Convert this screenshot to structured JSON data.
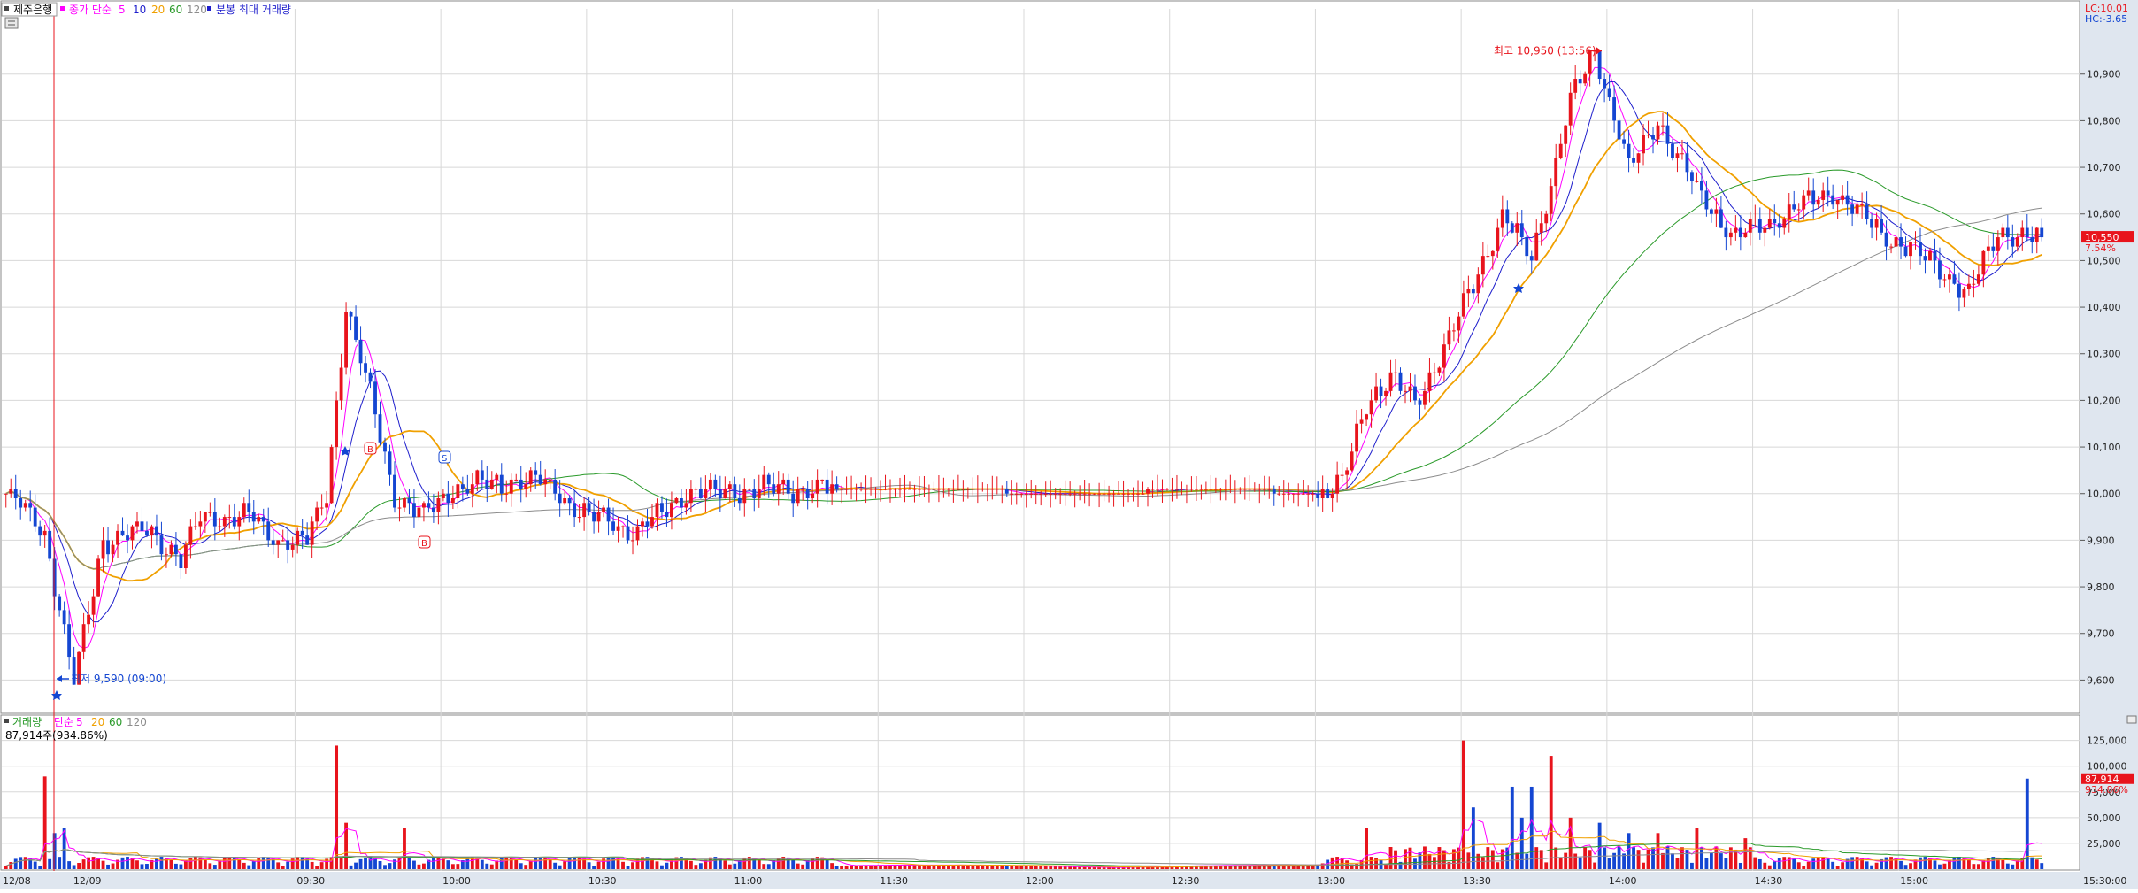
{
  "colors": {
    "up": "#e8141c",
    "down": "#1446d2",
    "ma5": "#ff00ff",
    "ma10": "#1e1ecc",
    "ma20": "#f0a000",
    "ma60": "#2a9a2a",
    "ma120": "#8c8c8c",
    "grid": "#d8d8d8",
    "axis_bg": "#dfe6ef",
    "high_marker": "#e8141c",
    "low_marker": "#1446d2"
  },
  "price_panel": {
    "stock_name": "제주은행",
    "ma_label": "종가 단순",
    "periods": [
      "5",
      "10",
      "20",
      "60",
      "120"
    ],
    "extra_label": "분봉 최대 거래량",
    "lc": "LC:10.01",
    "hc": "HC:-3.65",
    "current_price": "10,550",
    "current_change": "7.54%",
    "high_annotation": "최고 10,950 (13:56)",
    "low_annotation": "최저 9,590 (09:00)",
    "signal_b": "B",
    "signal_s": "S"
  },
  "volume_panel": {
    "title": "거래량",
    "ma_label": "단순",
    "periods": [
      "5",
      "20",
      "60",
      "120"
    ],
    "current_text": "87,914주(934.86%)",
    "current_volume": "87,914",
    "current_ratio": "934.86%"
  },
  "chart_data": [
    {
      "type": "candlestick",
      "title": "제주은행",
      "price_axis_ticks": [
        "9,600",
        "9,700",
        "9,800",
        "9,900",
        "10,000",
        "10,100",
        "10,200",
        "10,300",
        "10,400",
        "10,500",
        "10,600",
        "10,700",
        "10,800",
        "10,900"
      ],
      "price_axis_values": [
        9600,
        9700,
        9800,
        9900,
        10000,
        10100,
        10200,
        10300,
        10400,
        10500,
        10600,
        10700,
        10800,
        10900
      ],
      "time_axis_labels": [
        "12/08",
        "12/09",
        "09:30",
        "10:00",
        "10:30",
        "11:00",
        "11:30",
        "12:00",
        "12:30",
        "13:00",
        "13:30",
        "14:00",
        "14:30",
        "15:00",
        "15:30:00"
      ],
      "ylim": [
        9540,
        11040
      ],
      "high": {
        "value": 10950,
        "time": "13:56"
      },
      "low": {
        "value": 9590,
        "time": "09:00"
      },
      "last": 10550,
      "change_pct": 7.54,
      "price_path": [
        [
          0,
          10000
        ],
        [
          8,
          9920
        ],
        [
          14,
          9590
        ],
        [
          20,
          9900
        ],
        [
          30,
          9920
        ],
        [
          36,
          9860
        ],
        [
          40,
          9950
        ],
        [
          50,
          9950
        ],
        [
          56,
          9900
        ],
        [
          62,
          9900
        ],
        [
          66,
          10000
        ],
        [
          70,
          10400
        ],
        [
          74,
          10250
        ],
        [
          80,
          10000
        ],
        [
          86,
          9950
        ],
        [
          92,
          10010
        ],
        [
          100,
          10020
        ],
        [
          110,
          10030
        ],
        [
          120,
          9950
        ],
        [
          130,
          9920
        ],
        [
          140,
          10000
        ],
        [
          160,
          10010
        ],
        [
          190,
          10010
        ],
        [
          220,
          10000
        ],
        [
          250,
          10010
        ],
        [
          270,
          10000
        ],
        [
          275,
          10020
        ],
        [
          280,
          10200
        ],
        [
          285,
          10250
        ],
        [
          290,
          10190
        ],
        [
          300,
          10400
        ],
        [
          308,
          10600
        ],
        [
          314,
          10500
        ],
        [
          322,
          10840
        ],
        [
          327,
          10950
        ],
        [
          334,
          10700
        ],
        [
          340,
          10800
        ],
        [
          348,
          10650
        ],
        [
          356,
          10550
        ],
        [
          366,
          10600
        ],
        [
          376,
          10650
        ],
        [
          386,
          10560
        ],
        [
          396,
          10500
        ],
        [
          404,
          10430
        ],
        [
          410,
          10560
        ],
        [
          416,
          10550
        ]
      ],
      "moving_averages": [
        "5",
        "10",
        "20",
        "60",
        "120"
      ]
    },
    {
      "type": "bar",
      "title": "거래량",
      "volume_axis_ticks": [
        "25,000",
        "50,000",
        "75,000",
        "100,000",
        "125,000"
      ],
      "volume_axis_values": [
        25000,
        50000,
        75000,
        100000,
        125000
      ],
      "ylim": [
        0,
        135000
      ],
      "last_volume": 87914,
      "spikes": [
        [
          8,
          90000
        ],
        [
          10,
          35000
        ],
        [
          12,
          40000
        ],
        [
          68,
          120000
        ],
        [
          70,
          45000
        ],
        [
          82,
          40000
        ],
        [
          280,
          40000
        ],
        [
          300,
          125000
        ],
        [
          302,
          60000
        ],
        [
          310,
          80000
        ],
        [
          312,
          50000
        ],
        [
          314,
          80000
        ],
        [
          318,
          110000
        ],
        [
          322,
          50000
        ],
        [
          328,
          45000
        ],
        [
          334,
          35000
        ],
        [
          340,
          35000
        ],
        [
          348,
          40000
        ],
        [
          358,
          30000
        ],
        [
          416,
          87914
        ]
      ],
      "moving_averages": [
        "5",
        "20",
        "60",
        "120"
      ]
    }
  ]
}
